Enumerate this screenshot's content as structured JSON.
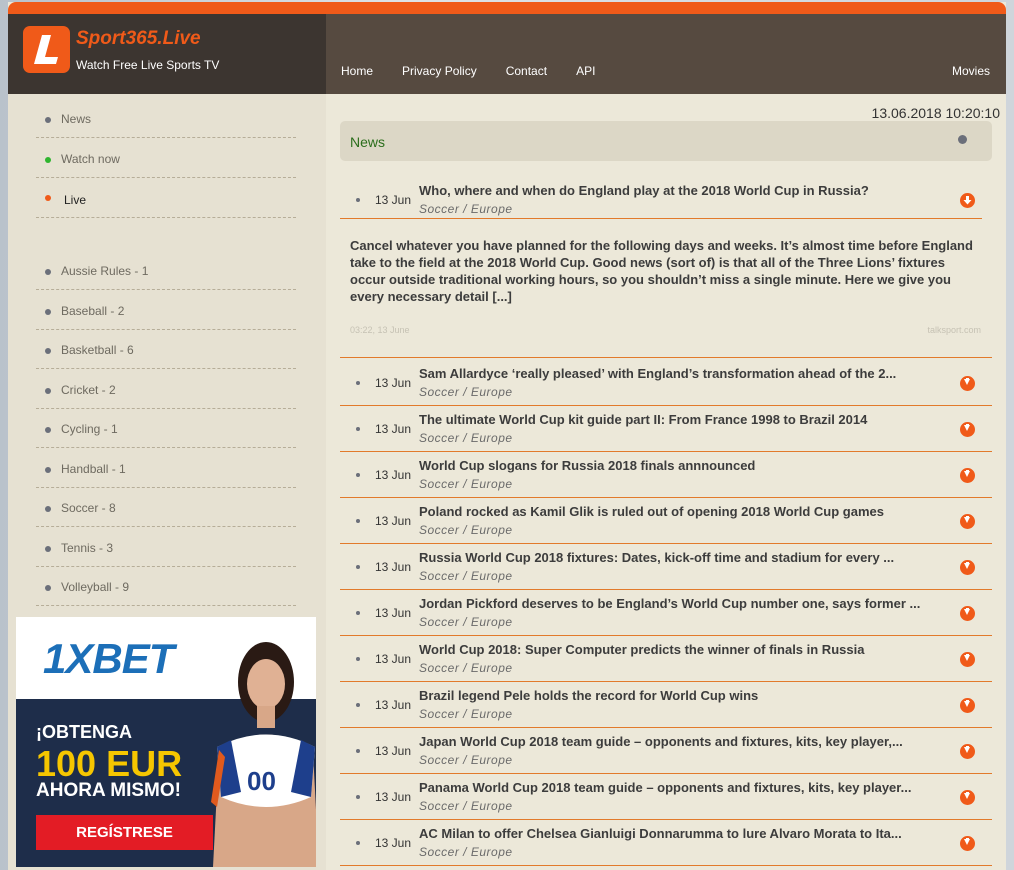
{
  "brand": {
    "name": "Sport365.Live",
    "tagline": "Watch Free Live Sports TV",
    "logo_letter": "L"
  },
  "nav": {
    "items": [
      "Home",
      "Privacy Policy",
      "Contact",
      "API"
    ],
    "right": "Movies"
  },
  "datetime": "13.06.2018  10:20:10",
  "sidebar": {
    "top": [
      {
        "label": "News",
        "dot": "#6b6f7a"
      },
      {
        "label": "Watch now",
        "dot": "#2fb52f"
      },
      {
        "label": "Live",
        "dot": "#f05a19"
      }
    ],
    "sports": [
      "Aussie Rules - 1",
      "Baseball - 2",
      "Basketball - 6",
      "Cricket - 2",
      "Cycling - 1",
      "Handball - 1",
      "Soccer - 8",
      "Tennis - 3",
      "Volleyball - 9"
    ]
  },
  "ad": {
    "logo": "1XBET",
    "line1": "¡OBTENGA",
    "line2": "100 EUR",
    "line3": "AHORA MISMO!",
    "button": "REGÍSTRESE"
  },
  "news": {
    "heading": "News",
    "expanded": {
      "date": "13 Jun",
      "title": "Who, where and when do England play at the 2018 World Cup in Russia?",
      "category": "Soccer / Europe",
      "body": "Cancel whatever you have planned for the following days and weeks. It’s almost time before England take to the field at the 2018 World Cup. Good news (sort of) is that all of the Three Lions’ fixtures occur outside traditional working hours, so you shouldn’t miss a single minute. Here we give you every necessary detail [...]",
      "time": "03:22, 13 June",
      "source": "talksport.com"
    },
    "items": [
      {
        "date": "13 Jun",
        "title": "Sam Allardyce ‘really pleased’ with England’s transformation ahead of the 2...",
        "category": "Soccer / Europe"
      },
      {
        "date": "13 Jun",
        "title": "The ultimate World Cup kit guide part II: From France 1998 to Brazil 2014",
        "category": "Soccer / Europe"
      },
      {
        "date": "13 Jun",
        "title": "World Cup slogans for Russia 2018 finals annnounced",
        "category": "Soccer / Europe"
      },
      {
        "date": "13 Jun",
        "title": "Poland rocked as Kamil Glik is ruled out of opening 2018 World Cup games",
        "category": "Soccer / Europe"
      },
      {
        "date": "13 Jun",
        "title": "Russia World Cup 2018 fixtures: Dates, kick-off time and stadium for every ...",
        "category": "Soccer / Europe"
      },
      {
        "date": "13 Jun",
        "title": "Jordan Pickford deserves to be England’s World Cup number one, says former ...",
        "category": "Soccer / Europe"
      },
      {
        "date": "13 Jun",
        "title": "World Cup 2018: Super Computer predicts the winner of finals in Russia",
        "category": "Soccer / Europe"
      },
      {
        "date": "13 Jun",
        "title": "Brazil legend Pele holds the record for World Cup wins",
        "category": "Soccer / Europe"
      },
      {
        "date": "13 Jun",
        "title": "Japan World Cup 2018 team guide – opponents and fixtures, kits, key player,...",
        "category": "Soccer / Europe"
      },
      {
        "date": "13 Jun",
        "title": "Panama World Cup 2018 team guide – opponents and fixtures, kits, key player...",
        "category": "Soccer / Europe"
      },
      {
        "date": "13 Jun",
        "title": "AC Milan to offer Chelsea Gianluigi Donnarumma to lure Alvaro Morata to Ita...",
        "category": "Soccer / Europe"
      }
    ]
  },
  "colors": {
    "accent": "#f05a19",
    "header": "#564a40",
    "panel": "#ece8d9",
    "green": "#2b6e1c"
  }
}
